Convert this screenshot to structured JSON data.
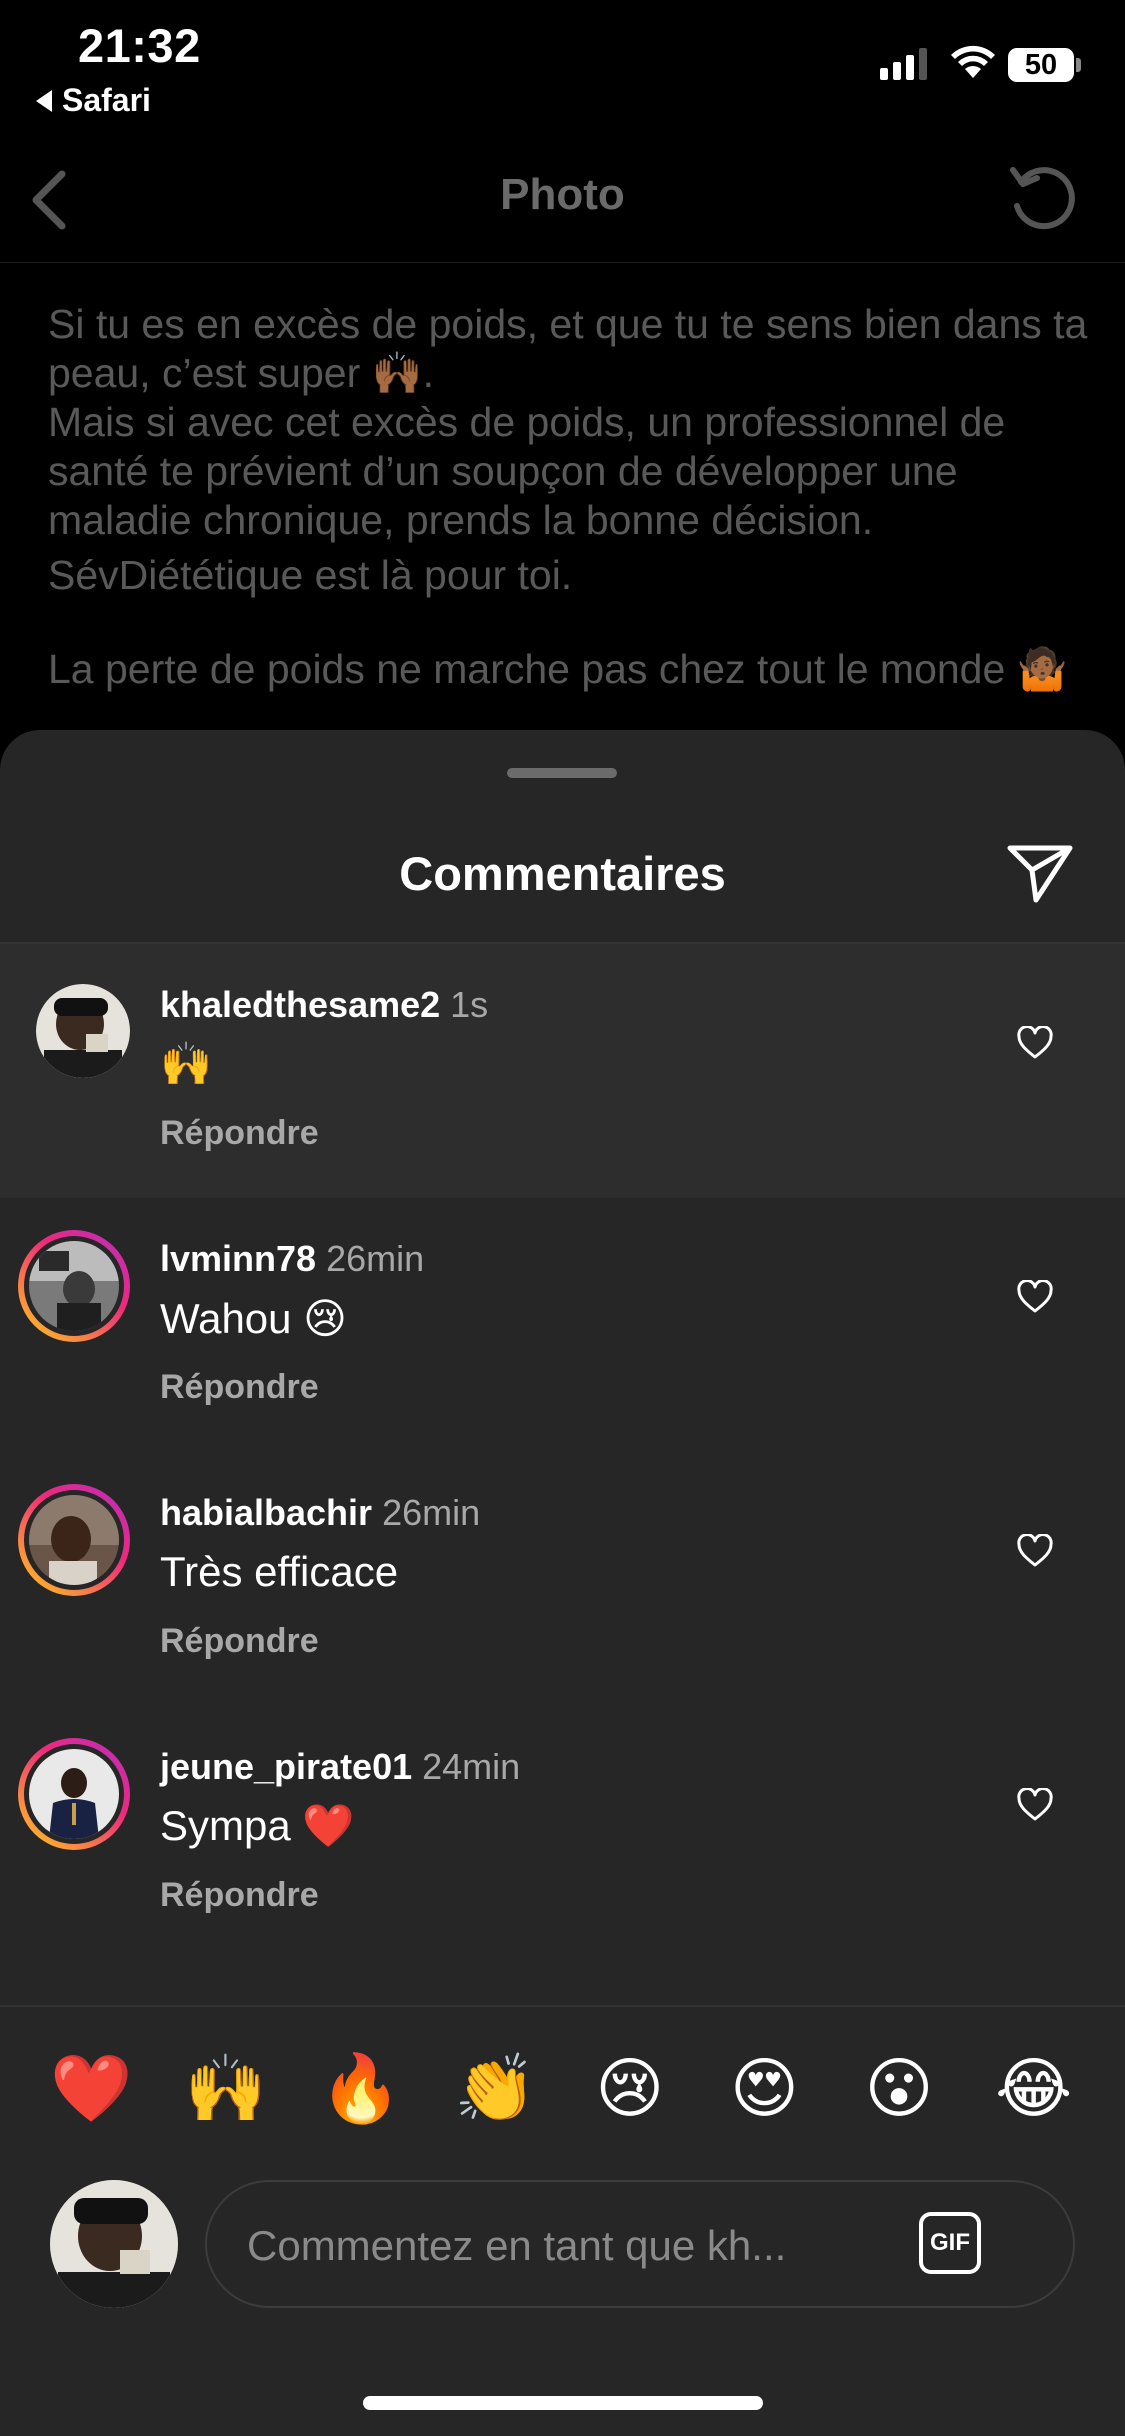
{
  "status": {
    "time": "21:32",
    "back_app": "Safari",
    "battery": "50"
  },
  "header": {
    "title": "Photo"
  },
  "caption": {
    "lines": [
      "Si tu es en excès de poids, et que tu te sens bien dans ta peau, c’est super 🙌🏾.",
      "Mais si avec cet excès de poids, un professionnel de santé te prévient d’un soupçon de développer une maladie chronique, prends la bonne décision.",
      "SévDiététique est là pour toi.",
      "La perte de poids ne marche pas chez tout le monde 🤷🏾"
    ]
  },
  "sheet": {
    "title": "Commentaires"
  },
  "comments": [
    {
      "user": "khaledthesame2",
      "ago": "1s",
      "text": "🙌",
      "reply": "Répondre"
    },
    {
      "user": "lvminn78",
      "ago": "26min",
      "text": "Wahou 😢",
      "reply": "Répondre"
    },
    {
      "user": "habialbachir",
      "ago": "26min",
      "text": "Très efficace",
      "reply": "Répondre"
    },
    {
      "user": "jeune_pirate01",
      "ago": "24min",
      "text": "Sympa ❤️",
      "reply": "Répondre"
    }
  ],
  "quick_reactions": [
    "❤️",
    "🙌",
    "🔥",
    "👏",
    "😢",
    "😍",
    "😮",
    "😂"
  ],
  "composer": {
    "placeholder": "Commentez en tant que kh...",
    "gif_label": "GIF"
  }
}
